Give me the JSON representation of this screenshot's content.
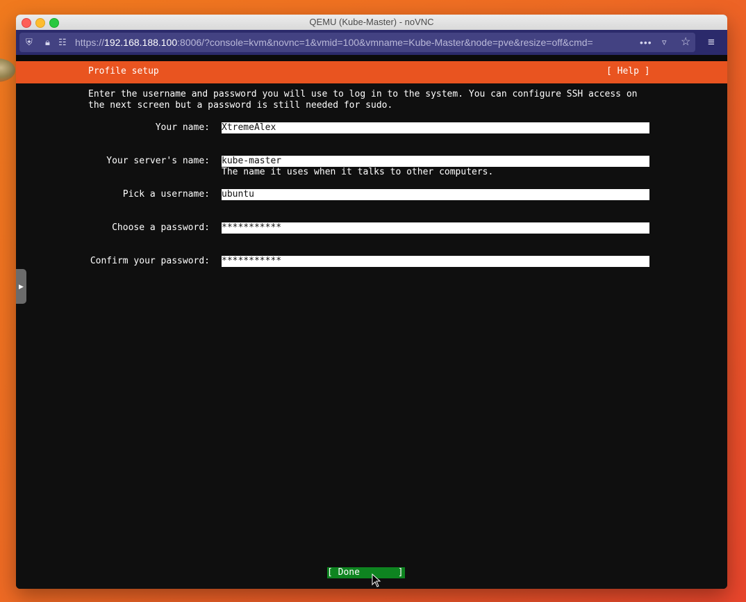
{
  "window": {
    "title": "QEMU (Kube-Master) - noVNC"
  },
  "browser": {
    "url_prefix": "https://",
    "url_host": "192.168.188.100",
    "url_rest": ":8006/?console=kvm&novnc=1&vmid=100&vmname=Kube-Master&node=pve&resize=off&cmd="
  },
  "installer": {
    "header_title": "Profile setup",
    "help_label": "[ Help ]",
    "intro": "Enter the username and password you will use to log in to the system. You can configure SSH access on\nthe next screen but a password is still needed for sudo.",
    "fields": [
      {
        "label": "Your name:",
        "value": "XtremeAlex"
      },
      {
        "label": "Your server's name:",
        "value": "kube-master",
        "help": "The name it uses when it talks to other computers."
      },
      {
        "label": "Pick a username:",
        "value": "ubuntu"
      },
      {
        "label": "Choose a password:",
        "value": "***********"
      },
      {
        "label": "Confirm your password:",
        "value": "***********"
      }
    ],
    "done_label": "[ Done       ]"
  },
  "colors": {
    "accent": "#e95420",
    "done_button": "#0e8420",
    "browser_toolbar": "#2b2a6b"
  },
  "icons": [
    "shield-icon",
    "lock-warning-icon",
    "permissions-icon",
    "more-icon",
    "pocket-icon",
    "bookmark-star-icon",
    "hamburger-menu-icon",
    "sidebar-handle-icon",
    "mouse-cursor-icon"
  ]
}
